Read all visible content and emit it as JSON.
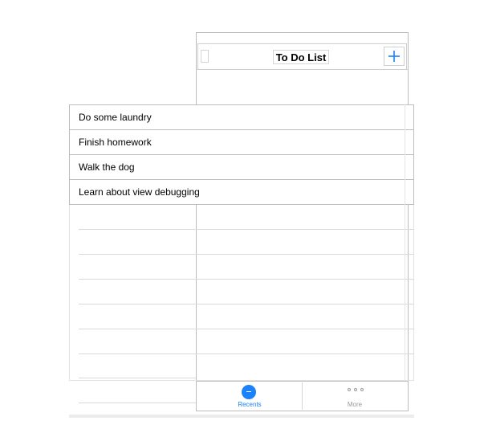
{
  "navbar": {
    "title": "To Do List",
    "add_icon": "plus-icon"
  },
  "todo_items": [
    "Do some laundry",
    "Finish homework",
    "Walk the dog",
    "Learn about view debugging"
  ],
  "tabbar": {
    "recents_label": "Recents",
    "recents_icon": "recents-icon",
    "more_label": "More",
    "more_icon": "more-icon"
  },
  "colors": {
    "accent": "#1a82fb",
    "separator": "#bdbdbd",
    "inactive_tab": "#9a9a9a"
  }
}
